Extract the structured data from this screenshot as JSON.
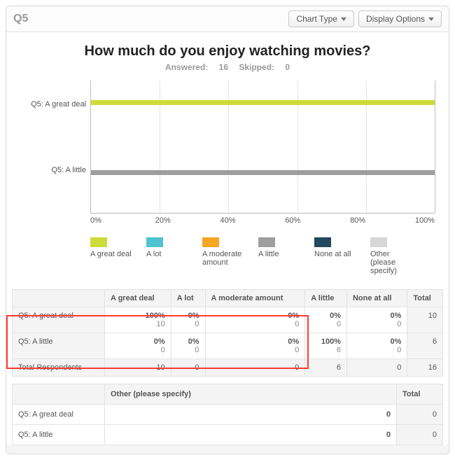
{
  "header": {
    "question_id": "Q5",
    "chart_type_btn": "Chart Type",
    "display_options_btn": "Display Options"
  },
  "title": "How much do you enjoy watching movies?",
  "stats": {
    "answered_label": "Answered:",
    "answered": 16,
    "skipped_label": "Skipped:",
    "skipped": 0
  },
  "chart_data": {
    "type": "bar",
    "orientation": "horizontal",
    "stacked": true,
    "xlabel": "",
    "ylabel": "",
    "xlim": [
      0,
      100
    ],
    "x_ticks": [
      "0%",
      "20%",
      "40%",
      "60%",
      "80%",
      "100%"
    ],
    "categories": [
      "Q5: A great deal",
      "Q5: A little"
    ],
    "series": [
      {
        "name": "A great deal",
        "color": "#cddc39",
        "values": [
          100,
          0
        ]
      },
      {
        "name": "A lot",
        "color": "#4fc3cf",
        "values": [
          0,
          0
        ]
      },
      {
        "name": "A moderate amount",
        "color": "#f5a623",
        "values": [
          0,
          0
        ]
      },
      {
        "name": "A little",
        "color": "#9e9e9e",
        "values": [
          0,
          100
        ]
      },
      {
        "name": "None at all",
        "color": "#24485e",
        "values": [
          0,
          0
        ]
      },
      {
        "name": "Other (please specify)",
        "color": "#d7d7d7",
        "values": [
          0,
          0
        ]
      }
    ]
  },
  "legend": {
    "items": [
      {
        "label": "A great deal",
        "key": "greatdeal"
      },
      {
        "label": "A lot",
        "key": "alot"
      },
      {
        "label": "A moderate amount",
        "key": "moderate"
      },
      {
        "label": "A little",
        "key": "alittle"
      },
      {
        "label": "None at all",
        "key": "none"
      },
      {
        "label": "Other (please specify)",
        "key": "other"
      }
    ]
  },
  "table": {
    "columns": [
      "A great deal",
      "A lot",
      "A moderate amount",
      "A little",
      "None at all",
      "Total"
    ],
    "rows": [
      {
        "label": "Q5: A great deal",
        "cells": [
          {
            "pct": "100%",
            "cnt": "10"
          },
          {
            "pct": "0%",
            "cnt": "0"
          },
          {
            "pct": "0%",
            "cnt": "0"
          },
          {
            "pct": "0%",
            "cnt": "0"
          },
          {
            "pct": "0%",
            "cnt": "0"
          }
        ],
        "total": "10"
      },
      {
        "label": "Q5: A little",
        "cells": [
          {
            "pct": "0%",
            "cnt": "0"
          },
          {
            "pct": "0%",
            "cnt": "0"
          },
          {
            "pct": "0%",
            "cnt": "0"
          },
          {
            "pct": "100%",
            "cnt": "6"
          },
          {
            "pct": "0%",
            "cnt": "0"
          }
        ],
        "total": "6"
      }
    ],
    "totals_row": {
      "label": "Total Respondents",
      "cells": [
        "10",
        "0",
        "0",
        "6",
        "0"
      ],
      "total": "16"
    }
  },
  "table2": {
    "col_other": "Other (please specify)",
    "col_total": "Total",
    "rows": [
      {
        "label": "Q5: A great deal",
        "other": "0",
        "total": "0"
      },
      {
        "label": "Q5: A little",
        "other": "0",
        "total": "0"
      }
    ]
  }
}
